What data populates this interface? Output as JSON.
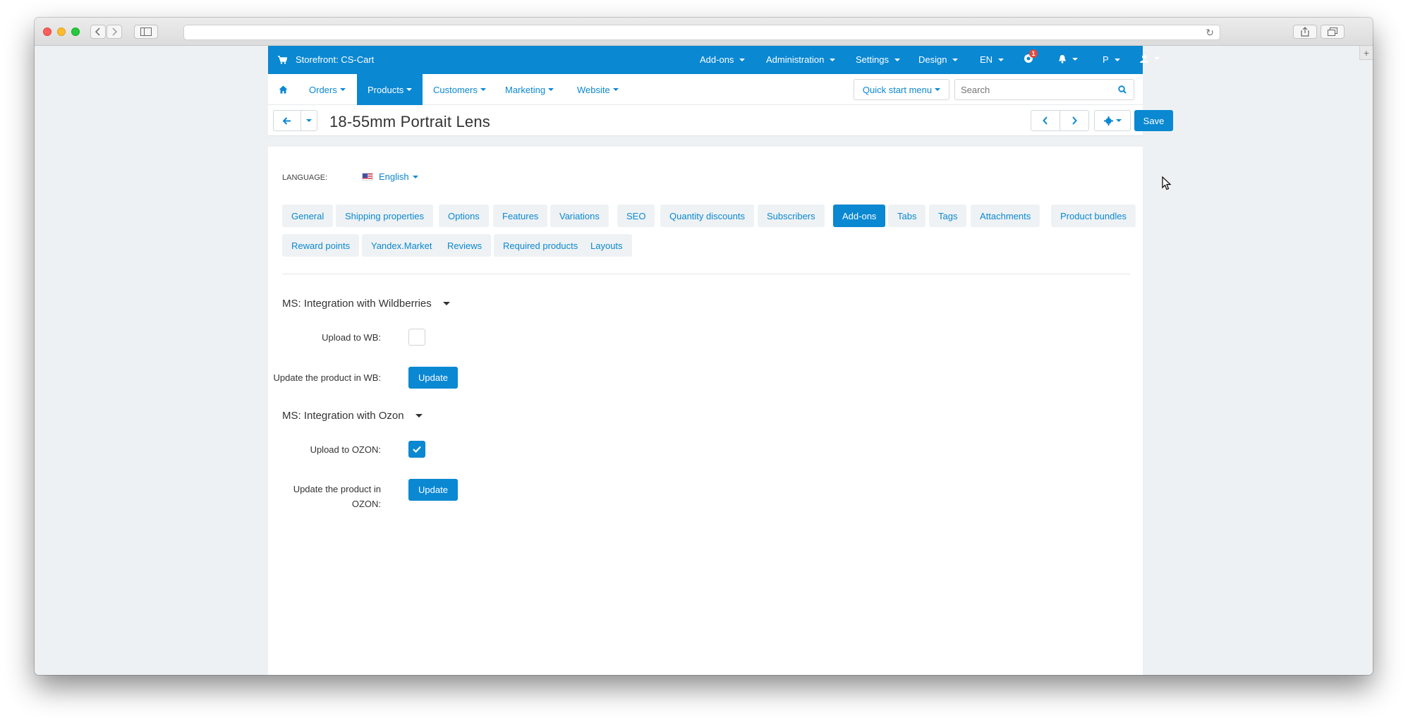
{
  "browser": {
    "url": ""
  },
  "topbar": {
    "store": "Storefront: CS-Cart",
    "menus": [
      "Add-ons",
      "Administration",
      "Settings",
      "Design",
      "EN"
    ],
    "notification_count": "1",
    "profile_letter": "P"
  },
  "navbar": {
    "items": [
      "Orders",
      "Products",
      "Customers",
      "Marketing",
      "Website"
    ],
    "quick_start": "Quick start menu",
    "search_placeholder": "Search"
  },
  "page": {
    "title": "18-55mm Portrait Lens",
    "save_label": "Save"
  },
  "language": {
    "label": "LANGUAGE:",
    "value": "English"
  },
  "tabs": [
    "General",
    "Shipping properties",
    "Options",
    "Features",
    "Variations",
    "SEO",
    "Quantity discounts",
    "Subscribers",
    "Add-ons",
    "Tabs",
    "Tags",
    "Attachments",
    "Product bundles",
    "Reward points",
    "Yandex.Market",
    "Reviews",
    "Required products",
    "Layouts"
  ],
  "active_tab": "Add-ons",
  "sections": {
    "wb": {
      "title": "MS: Integration with Wildberries",
      "upload_label": "Upload to WB:",
      "upload_checked": false,
      "update_label": "Update the product in WB:",
      "update_button": "Update"
    },
    "ozon": {
      "title": "MS: Integration with Ozon",
      "upload_label": "Upload to OZON:",
      "upload_checked": true,
      "update_label": "Update the product in OZON:",
      "update_button": "Update"
    }
  },
  "colors": {
    "accent": "#0a88d2",
    "background": "#eef1f3",
    "tab_bg": "#eff2f4"
  }
}
